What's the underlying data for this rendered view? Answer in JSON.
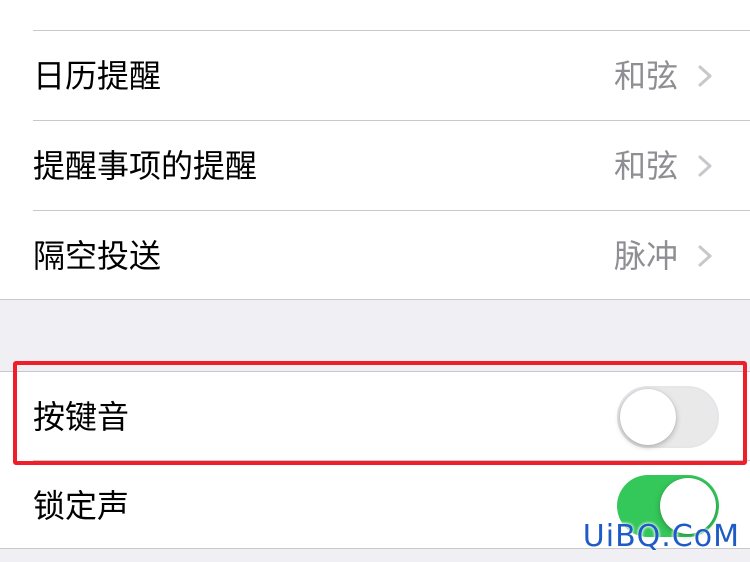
{
  "settings": {
    "top_group": [
      {
        "label": "",
        "value": "",
        "partial": true
      },
      {
        "label": "日历提醒",
        "value": "和弦"
      },
      {
        "label": "提醒事项的提醒",
        "value": "和弦"
      },
      {
        "label": "隔空投送",
        "value": "脉冲"
      }
    ],
    "bottom_group": [
      {
        "label": "按键音",
        "toggle": "off"
      },
      {
        "label": "锁定声",
        "toggle": "on"
      }
    ]
  },
  "icons": {
    "disclosure": "chevron-right-icon"
  },
  "colors": {
    "highlight_border": "#f01e28",
    "toggle_on": "#34c759",
    "toggle_off": "#e9e9ea",
    "secondary_text": "#8e8e93",
    "watermark": "#1e5bc6"
  },
  "watermark": {
    "text": "UiBQ.CoM"
  }
}
